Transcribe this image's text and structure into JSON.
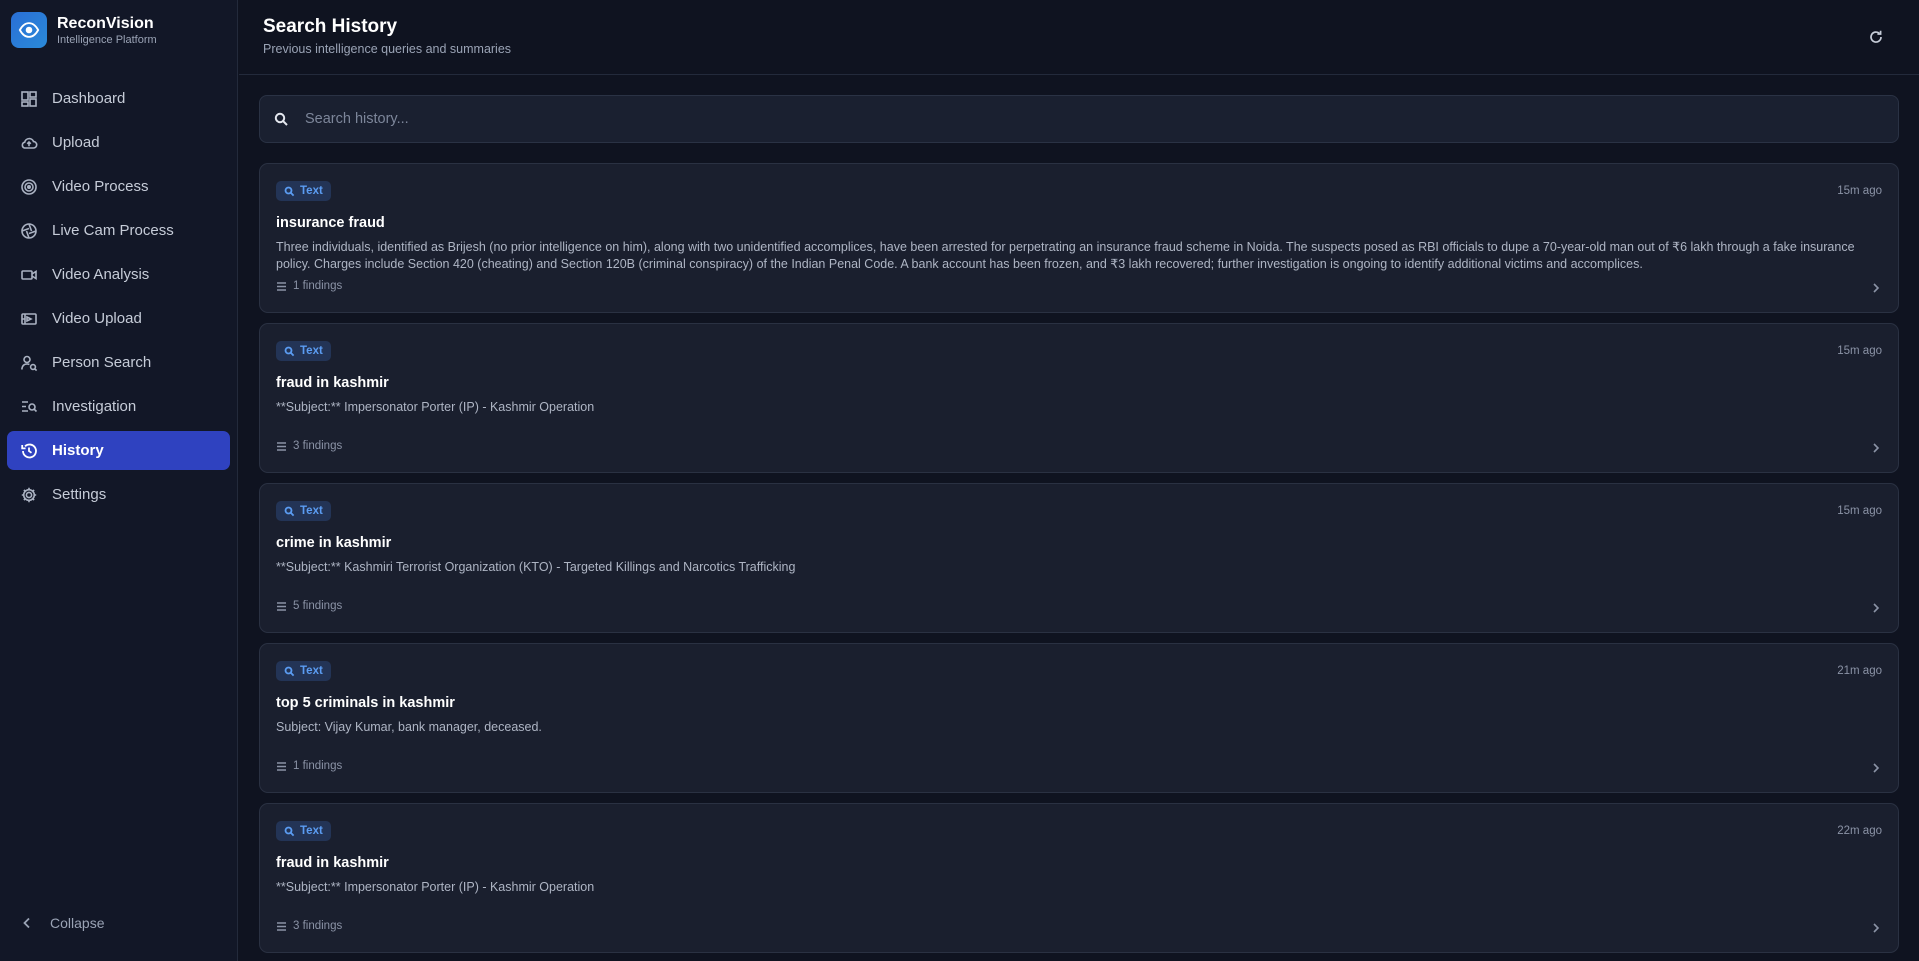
{
  "app": {
    "name": "ReconVision",
    "tagline": "Intelligence Platform",
    "brand_color": "#2a6fd6",
    "accent_color": "#2f42c0"
  },
  "sidebar": {
    "items": [
      {
        "label": "Dashboard",
        "icon": "dashboard-icon",
        "active": false
      },
      {
        "label": "Upload",
        "icon": "cloud-upload-icon",
        "active": false
      },
      {
        "label": "Video Process",
        "icon": "target-icon",
        "active": false
      },
      {
        "label": "Live Cam Process",
        "icon": "camera-shutter-icon",
        "active": false
      },
      {
        "label": "Video Analysis",
        "icon": "video-camera-icon",
        "active": false
      },
      {
        "label": "Video Upload",
        "icon": "video-file-icon",
        "active": false
      },
      {
        "label": "Person Search",
        "icon": "person-search-icon",
        "active": false
      },
      {
        "label": "Investigation",
        "icon": "list-search-icon",
        "active": false
      },
      {
        "label": "History",
        "icon": "history-icon",
        "active": true
      },
      {
        "label": "Settings",
        "icon": "gear-icon",
        "active": false
      }
    ],
    "collapse_label": "Collapse"
  },
  "header": {
    "title": "Search History",
    "subtitle": "Previous intelligence queries and summaries",
    "refresh_icon": "refresh-icon"
  },
  "search": {
    "placeholder": "Search history...",
    "value": ""
  },
  "history": [
    {
      "type": "Text",
      "time": "15m ago",
      "title": "insurance fraud",
      "summary": "Three individuals, identified as Brijesh (no prior intelligence on him), along with two unidentified accomplices, have been arrested for perpetrating an insurance fraud scheme in Noida. The suspects posed as RBI officials to dupe a 70-year-old man out of ₹6 lakh through a fake insurance policy. Charges include Section 420 (cheating) and Section 120B (criminal conspiracy) of the Indian Penal Code. A bank account has been frozen, and ₹3 lakh recovered; further investigation is ongoing to identify additional victims and accomplices.",
      "findings": "1 findings"
    },
    {
      "type": "Text",
      "time": "15m ago",
      "title": "fraud in kashmir",
      "summary": "**Subject:** Impersonator Porter (IP) - Kashmir Operation",
      "findings": "3 findings"
    },
    {
      "type": "Text",
      "time": "15m ago",
      "title": "crime in kashmir",
      "summary": "**Subject:** Kashmiri Terrorist Organization (KTO) - Targeted Killings and Narcotics Trafficking",
      "findings": "5 findings"
    },
    {
      "type": "Text",
      "time": "21m ago",
      "title": "top 5 criminals in kashmir",
      "summary": "Subject: Vijay Kumar, bank manager, deceased.",
      "findings": "1 findings"
    },
    {
      "type": "Text",
      "time": "22m ago",
      "title": "fraud in kashmir",
      "summary": "**Subject:** Impersonator Porter (IP) - Kashmir Operation",
      "findings": "3 findings"
    }
  ]
}
